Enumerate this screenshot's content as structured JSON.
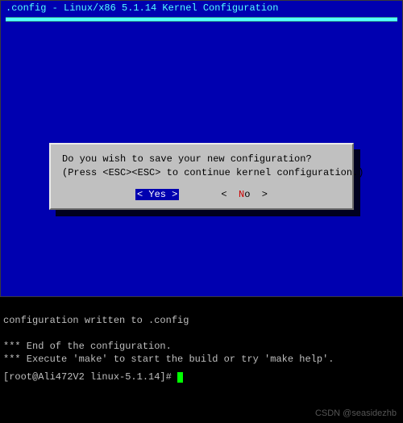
{
  "title": ".config - Linux/x86 5.1.14 Kernel Configuration",
  "dialog": {
    "line1": "Do you wish to save your new configuration?",
    "line2": "(Press <ESC><ESC> to continue kernel configuration.)",
    "yes_open": "< ",
    "yes_hot": "Y",
    "yes_rest": "es >",
    "no_open": "<  ",
    "no_hot": "N",
    "no_rest": "o  >"
  },
  "terminal": {
    "line1": "configuration written to .config",
    "blank": "",
    "line2": "*** End of the configuration.",
    "line3": "*** Execute 'make' to start the build or try 'make help'.",
    "prompt": "[root@Ali472V2 linux-5.1.14]# "
  },
  "watermark": "CSDN @seasidezhb"
}
